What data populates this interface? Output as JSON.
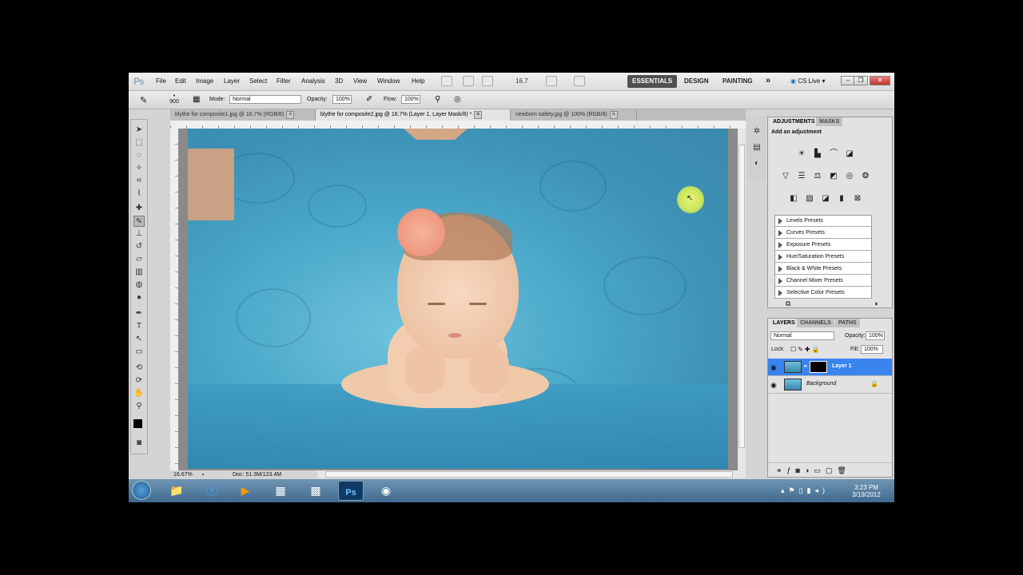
{
  "app": {
    "logo": "Ps"
  },
  "menu": [
    "File",
    "Edit",
    "Image",
    "Layer",
    "Select",
    "Filter",
    "Analysis",
    "3D",
    "View",
    "Window",
    "Help"
  ],
  "menubar": {
    "zoom_value": "16.7",
    "workspaces": [
      "ESSENTIALS",
      "DESIGN",
      "PAINTING"
    ],
    "more": "»",
    "cslive": "CS Live"
  },
  "options": {
    "brush_size": "900",
    "mode_label": "Mode:",
    "mode_value": "Normal",
    "opacity_label": "Opacity:",
    "opacity_value": "100%",
    "flow_label": "Flow:",
    "flow_value": "100%"
  },
  "tabs": [
    {
      "label": "blythe for composite1.jpg @ 16.7% (RGB/8)"
    },
    {
      "label": "blythe for composite2.jpg @ 16.7% (Layer 1, Layer Mask/8) *"
    },
    {
      "label": "newborn safety.jpg @ 100% (RGB/8)"
    }
  ],
  "status": {
    "zoom": "16.67%",
    "doc": "Doc: 51.3M/123.4M"
  },
  "adjustments": {
    "tab_adjustments": "ADJUSTMENTS",
    "tab_masks": "MASKS",
    "heading": "Add an adjustment",
    "presets": [
      "Levels Presets",
      "Curves Presets",
      "Exposure Presets",
      "Hue/Saturation Presets",
      "Black & White Presets",
      "Channel Mixer Presets",
      "Selective Color Presets"
    ]
  },
  "layers": {
    "tab_layers": "LAYERS",
    "tab_channels": "CHANNELS",
    "tab_paths": "PATHS",
    "blend_mode": "Normal",
    "opacity_label": "Opacity:",
    "opacity_value": "100%",
    "lock_label": "Lock:",
    "fill_label": "Fill:",
    "fill_value": "100%",
    "items": [
      {
        "name": "Layer 1"
      },
      {
        "name": "Background"
      }
    ]
  },
  "taskbar": {
    "time": "3:23 PM",
    "date": "3/19/2012"
  }
}
